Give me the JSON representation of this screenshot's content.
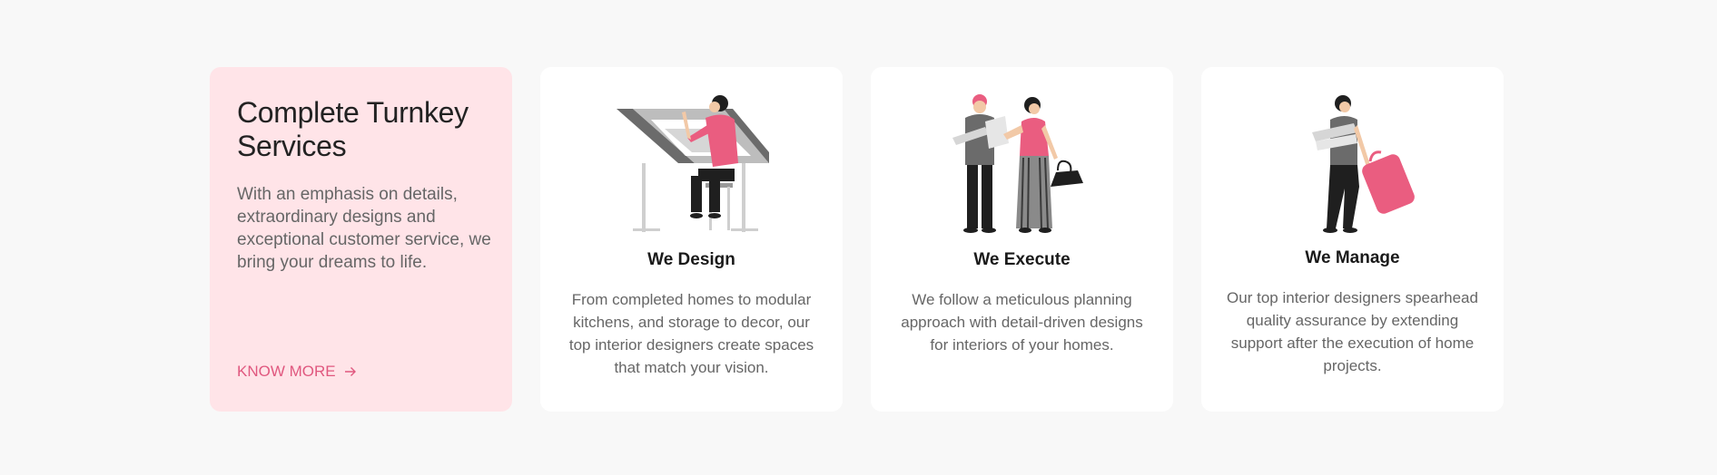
{
  "intro": {
    "title": "Complete Turnkey Services",
    "description": "With an emphasis on details, extraordinary designs and exceptional customer service, we bring your dreams to life.",
    "cta_label": "KNOW MORE"
  },
  "services": [
    {
      "title": "We Design",
      "description": "From completed homes to modular kitchens, and storage to decor, our top interior designers create spaces that match your vision.",
      "illustration": "designer-at-drafting-table-illustration"
    },
    {
      "title": "We Execute",
      "description": "We follow a meticulous planning approach with detail-driven designs for interiors of your homes.",
      "illustration": "team-planning-illustration"
    },
    {
      "title": "We Manage",
      "description": "Our top interior designers spearhead quality assurance by extending support after the execution of home projects.",
      "illustration": "woman-with-suitcase-illustration"
    }
  ],
  "colors": {
    "accent": "#e0587f",
    "intro_bg": "#ffe4e8",
    "page_bg": "#f8f8f8"
  }
}
